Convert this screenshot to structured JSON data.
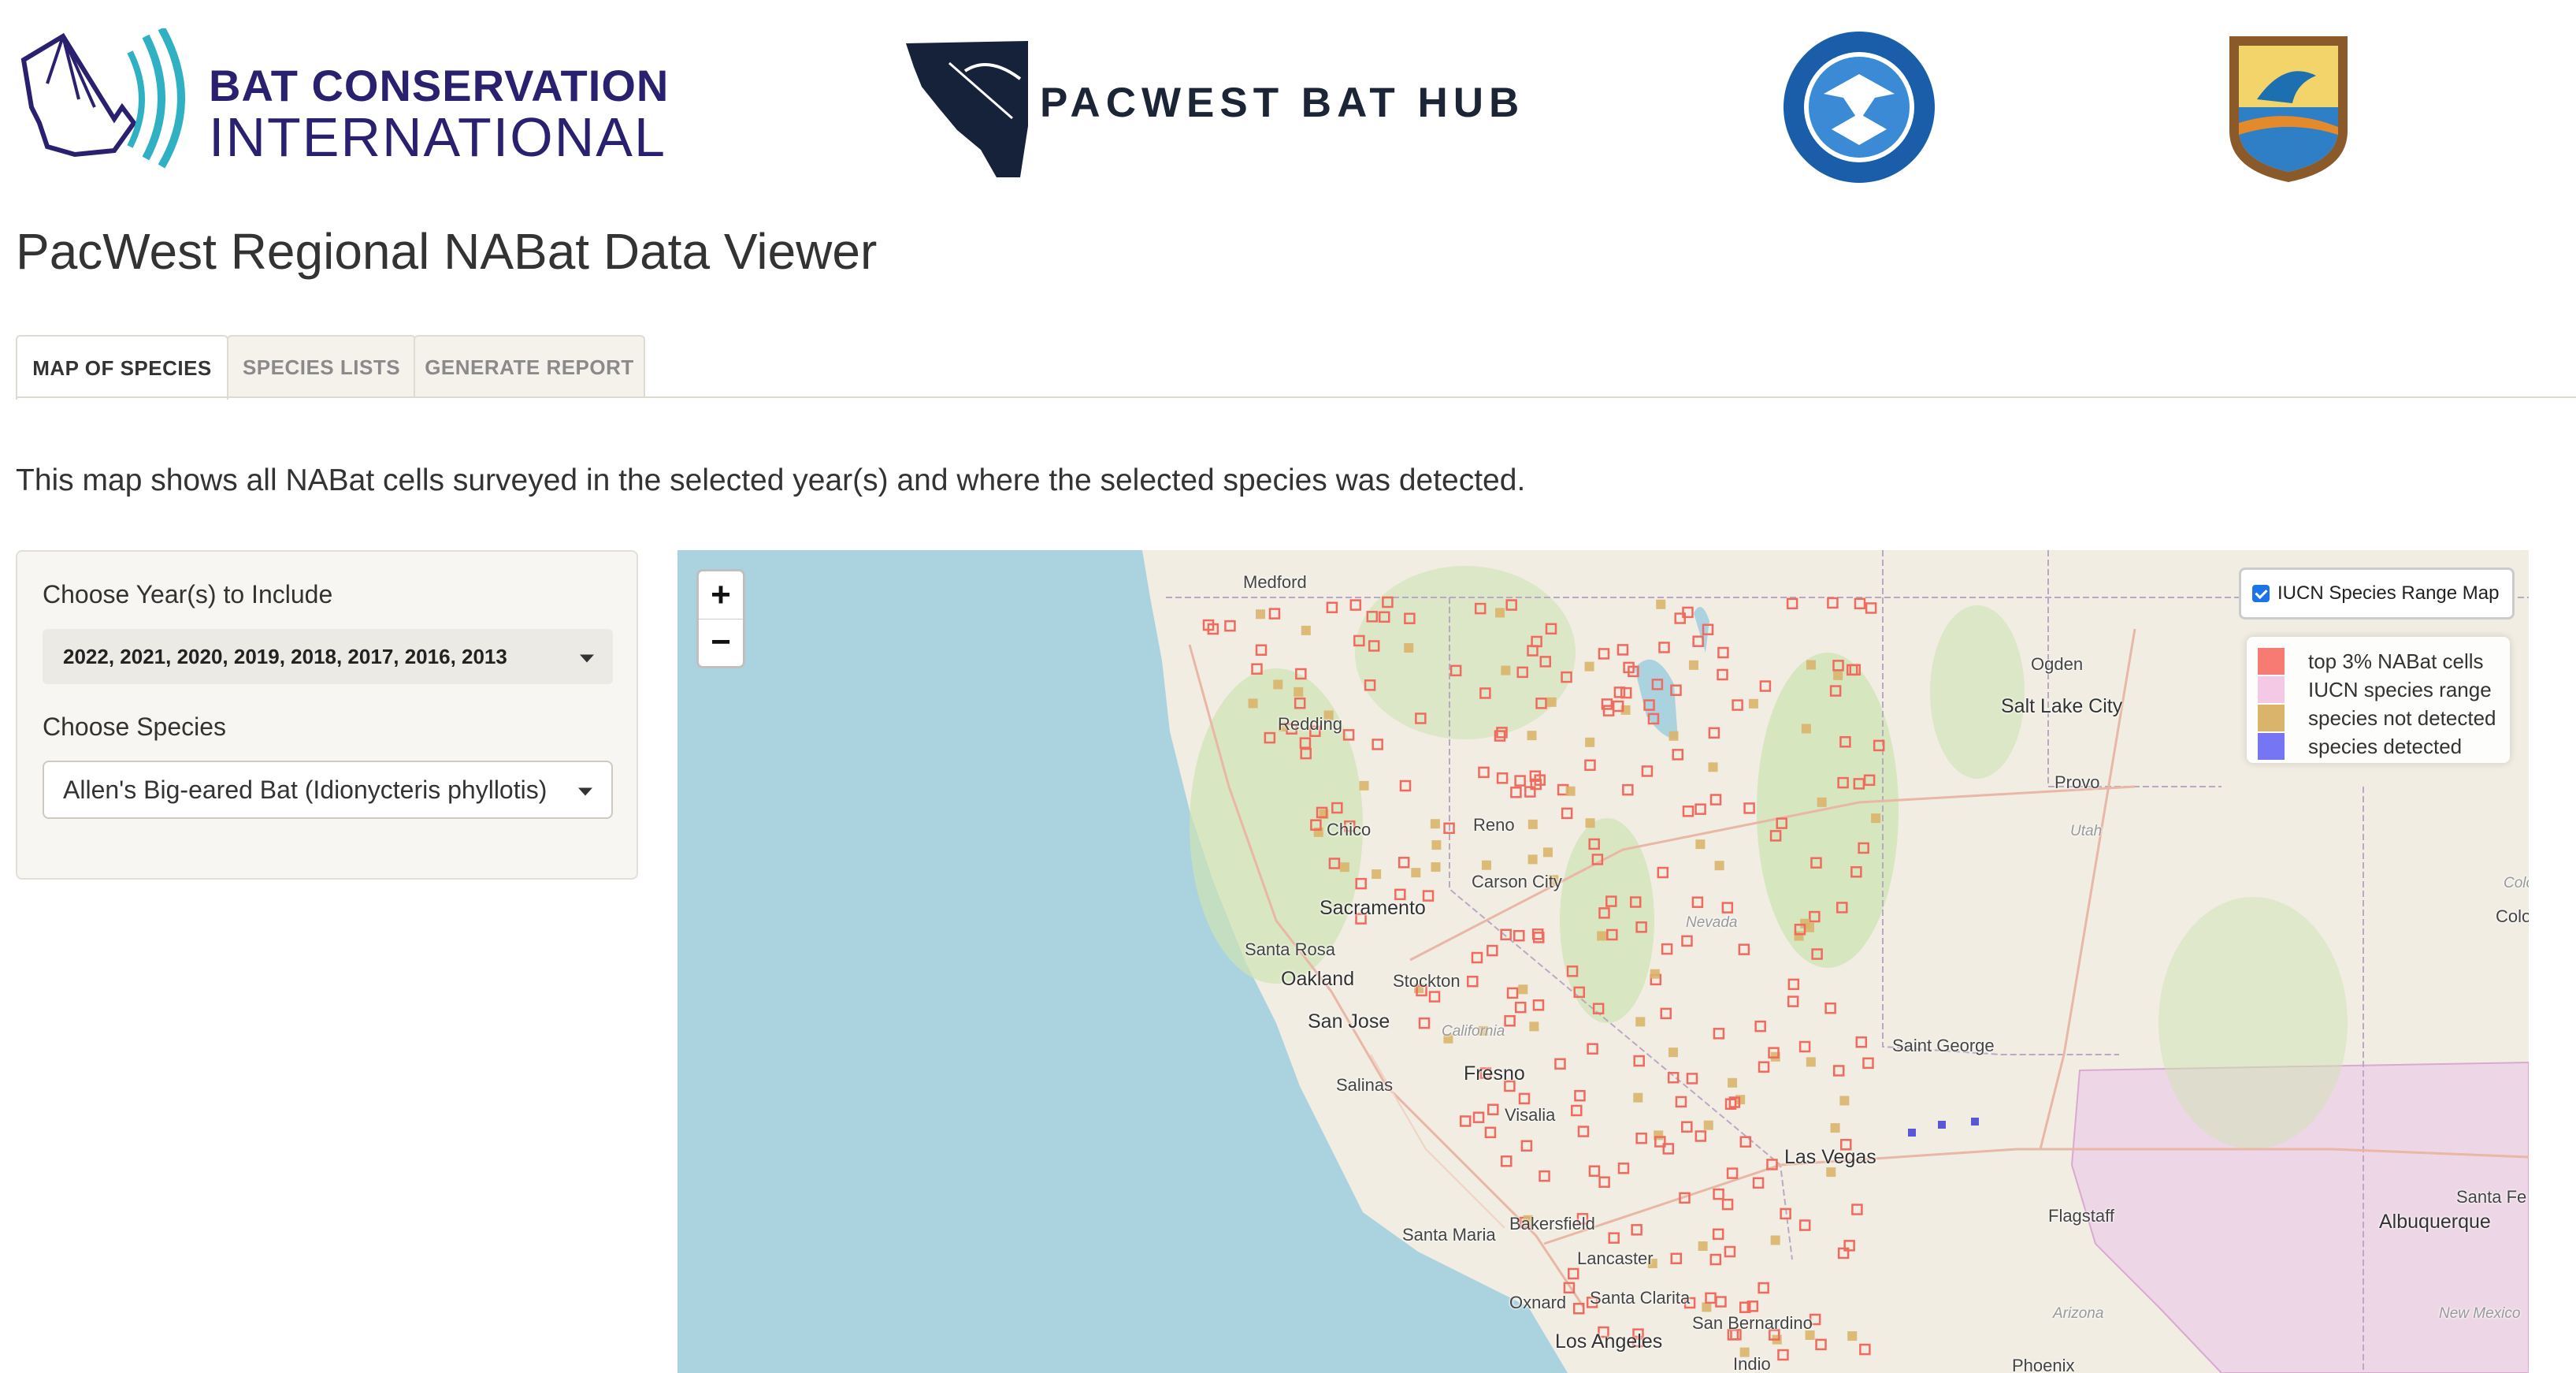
{
  "logos": {
    "bci_line1": "BAT CONSERVATION",
    "bci_line2": "INTERNATIONAL",
    "pacwest": "PACWEST BAT HUB"
  },
  "page": {
    "title": "PacWest Regional NABat Data Viewer",
    "description": "This map shows all NABat cells surveyed in the selected year(s) and where the selected species was detected."
  },
  "tabs": [
    {
      "label": "MAP OF SPECIES",
      "active": true
    },
    {
      "label": "SPECIES LISTS",
      "active": false
    },
    {
      "label": "GENERATE REPORT",
      "active": false
    }
  ],
  "sidebar": {
    "years_label": "Choose Year(s) to Include",
    "years_value": "2022, 2021, 2020, 2019, 2018, 2017, 2016, 2013",
    "species_label": "Choose Species",
    "species_value": "Allen's Big-eared Bat (Idionycteris phyllotis)"
  },
  "map": {
    "zoom_in": "+",
    "zoom_out": "−",
    "layer_toggle": "IUCN Species Range Map",
    "layer_checked": true,
    "legend": [
      {
        "label": "top 3% NABat cells",
        "color": "#f77b72"
      },
      {
        "label": "IUCN species range",
        "color": "#f3c9e6"
      },
      {
        "label": "species not detected",
        "color": "#d9b46a"
      },
      {
        "label": "species detected",
        "color": "#7676f5"
      }
    ],
    "places": [
      "Medford",
      "Ogden",
      "Salt Lake City",
      "Redding",
      "Provo",
      "Utah",
      "Chico",
      "Reno",
      "Carson City",
      "Sacramento",
      "Nevada",
      "Colora",
      "Colo",
      "Santa Rosa",
      "Oakland",
      "Stockton",
      "San Jose",
      "California",
      "Saint George",
      "Fresno",
      "Salinas",
      "Visalia",
      "Las Vegas",
      "Flagstaff",
      "Santa Fe",
      "Albuquerque",
      "Santa Maria",
      "Bakersfield",
      "Lancaster",
      "Arizona",
      "New Mexico",
      "Oxnard",
      "Santa Clarita",
      "San Bernardino",
      "Los Angeles",
      "Indio",
      "Phoenix"
    ]
  }
}
